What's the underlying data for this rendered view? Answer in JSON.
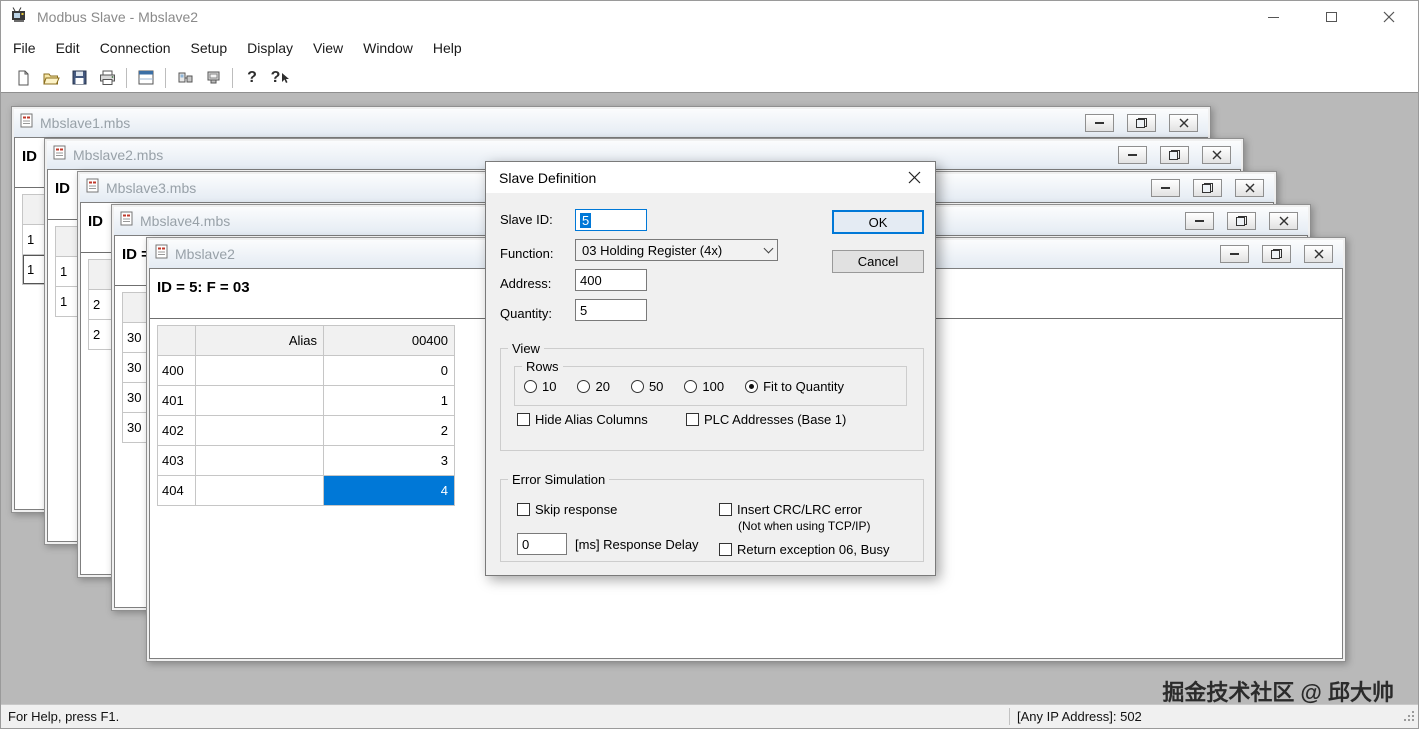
{
  "app": {
    "title": "Modbus Slave - Mbslave2"
  },
  "menu": {
    "items": [
      "File",
      "Edit",
      "Connection",
      "Setup",
      "Display",
      "View",
      "Window",
      "Help"
    ]
  },
  "toolbar": {
    "help_glyph": "?",
    "context_help_glyph": "?"
  },
  "mdi": {
    "background_color": "#b9b9b9",
    "windows": [
      {
        "title": "Mbslave1.mbs",
        "id_text": "ID",
        "rows": [
          "1",
          "1"
        ]
      },
      {
        "title": "Mbslave2.mbs",
        "id_text": "ID",
        "rows": [
          "1",
          "1"
        ]
      },
      {
        "title": "Mbslave3.mbs",
        "id_text": "ID",
        "rows": [
          "2",
          "2"
        ]
      },
      {
        "title": "Mbslave4.mbs",
        "id_text": "ID =",
        "rows": [
          "30",
          "30",
          "30",
          "30"
        ]
      }
    ],
    "active_window": {
      "title": "Mbslave2",
      "id_text": "ID = 5: F = 03",
      "table": {
        "headers": {
          "alias": "Alias",
          "value": "00400"
        },
        "rows": [
          {
            "addr": "400",
            "alias": "",
            "value": "0"
          },
          {
            "addr": "401",
            "alias": "",
            "value": "1"
          },
          {
            "addr": "402",
            "alias": "",
            "value": "2"
          },
          {
            "addr": "403",
            "alias": "",
            "value": "3"
          },
          {
            "addr": "404",
            "alias": "",
            "value": "4"
          }
        ],
        "selected_cell": "404",
        "selection_color": "#0078d7"
      }
    }
  },
  "dialog": {
    "title": "Slave Definition",
    "slave_id_label": "Slave ID:",
    "slave_id_value": "5",
    "function_label": "Function:",
    "function_value": "03 Holding Register (4x)",
    "address_label": "Address:",
    "address_value": "400",
    "quantity_label": "Quantity:",
    "quantity_value": "5",
    "ok_label": "OK",
    "cancel_label": "Cancel",
    "view_group_title": "View",
    "rows_group_title": "Rows",
    "rows_options": [
      "10",
      "20",
      "50",
      "100",
      "Fit to Quantity"
    ],
    "rows_selected": "Fit to Quantity",
    "hide_alias_label": "Hide Alias Columns",
    "plc_label": "PLC Addresses (Base 1)",
    "error_group_title": "Error Simulation",
    "skip_response_label": "Skip response",
    "crc_label": "Insert CRC/LRC error",
    "crc_note": "(Not when using TCP/IP)",
    "delay_value": "0",
    "delay_label": "[ms] Response Delay",
    "exception_label": "Return exception 06, Busy"
  },
  "statusbar": {
    "left": "For Help, press F1.",
    "right": "[Any IP Address]: 502"
  },
  "watermark": "掘金技术社区 @ 邱大帅",
  "accent_color": "#0078d7"
}
